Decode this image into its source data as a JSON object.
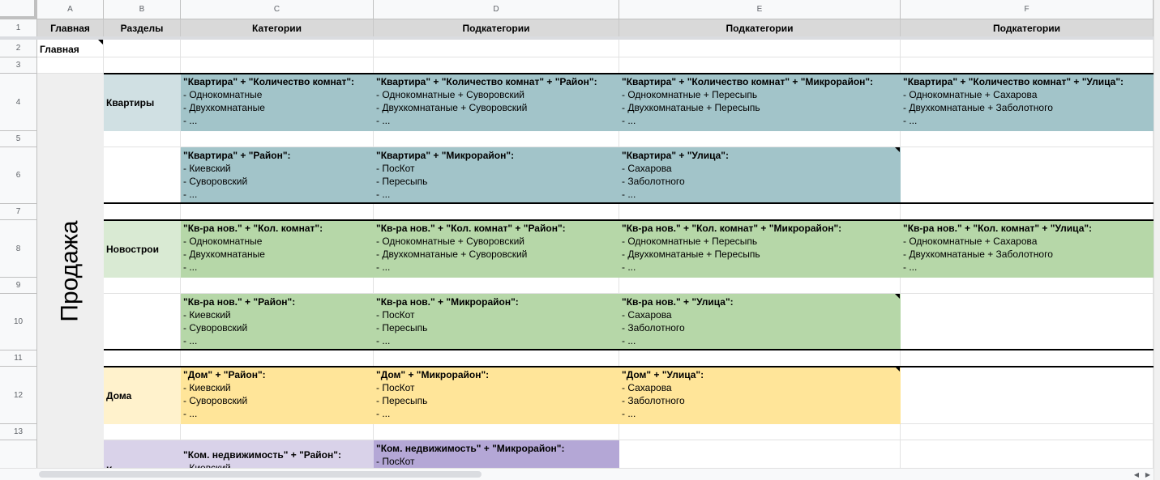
{
  "columns": [
    "A",
    "B",
    "C",
    "D",
    "E",
    "F"
  ],
  "rows": [
    "1",
    "2",
    "3",
    "4",
    "5",
    "6",
    "7",
    "8",
    "9",
    "10",
    "11",
    "12",
    "13"
  ],
  "header_row": [
    "Главная",
    "Разделы",
    "Категории",
    "Подкатегории",
    "Подкатегории",
    "Подкатегории"
  ],
  "a2": "Главная",
  "vertical_label": "Продажа",
  "sections": {
    "kvartiry": "Квартиры",
    "novostroi": "Новострои",
    "doma": "Дома",
    "kommercheskaya": "Коммерческая"
  },
  "r4": [
    {
      "title": "\"Квартира\" + \"Количество комнат\":",
      "lines": [
        "- Однокомнатные",
        "- Двухкомнатаные",
        "- ..."
      ]
    },
    {
      "title": "\"Квартира\" + \"Количество комнат\" + \"Район\":",
      "lines": [
        "- Однокомнатные + Суворовский",
        "- Двухкомнатаные + Суворовский",
        "- ..."
      ]
    },
    {
      "title": "\"Квартира\" + \"Количество комнат\" + \"Микрорайон\":",
      "lines": [
        "- Однокомнатные + Пересыпь",
        "- Двухкомнатаные + Пересыпь",
        "- ..."
      ]
    },
    {
      "title": "\"Квартира\" + \"Количество комнат\" + \"Улица\":",
      "lines": [
        "- Однокомнатные + Сахарова",
        "- Двухкомнатаные + Заболотного",
        "- ..."
      ]
    }
  ],
  "r6": [
    {
      "title": "\"Квартира\" + \"Район\":",
      "lines": [
        "- Киевский",
        "- Суворовский",
        "- ..."
      ]
    },
    {
      "title": "\"Квартира\" + \"Микрорайон\":",
      "lines": [
        "- ПосКот",
        "- Пересыпь",
        "- ..."
      ]
    },
    {
      "title": "\"Квартира\" + \"Улица\":",
      "lines": [
        "- Сахарова",
        "- Заболотного",
        "- ..."
      ]
    }
  ],
  "r8": [
    {
      "title": "\"Кв-ра нов.\" + \"Кол. комнат\":",
      "lines": [
        "- Однокомнатные",
        "- Двухкомнатаные",
        "- ..."
      ]
    },
    {
      "title": "\"Кв-ра нов.\" + \"Кол. комнат\" + \"Район\":",
      "lines": [
        "- Однокомнатные + Суворовский",
        "- Двухкомнатаные + Суворовский",
        "- ..."
      ]
    },
    {
      "title": "\"Кв-ра нов.\" + \"Кол. комнат\" + \"Микрорайон\":",
      "lines": [
        "- Однокомнатные + Пересыпь",
        "- Двухкомнатаные + Пересыпь",
        "- ..."
      ]
    },
    {
      "title": "\"Кв-ра нов.\" + \"Кол. комнат\" + \"Улица\":",
      "lines": [
        "- Однокомнатные + Сахарова",
        "- Двухкомнатаные + Заболотного",
        "- ..."
      ]
    }
  ],
  "r10": [
    {
      "title": "\"Кв-ра нов.\" + \"Район\":",
      "lines": [
        "- Киевский",
        "- Суворовский",
        "- ..."
      ]
    },
    {
      "title": "\"Кв-ра нов.\" + \"Микрорайон\":",
      "lines": [
        "- ПосКот",
        "- Пересыпь",
        "- ..."
      ]
    },
    {
      "title": "\"Кв-ра нов.\" + \"Улица\":",
      "lines": [
        "- Сахарова",
        "- Заболотного",
        "- ..."
      ]
    }
  ],
  "r12": [
    {
      "title": "\"Дом\" + \"Район\":",
      "lines": [
        "- Киевский",
        "- Суворовский",
        "- ..."
      ]
    },
    {
      "title": "\"Дом\" + \"Микрорайон\":",
      "lines": [
        "- ПосКот",
        "- Пересыпь",
        "- ..."
      ]
    },
    {
      "title": "\"Дом\" + \"Улица\":",
      "lines": [
        "- Сахарова",
        "- Заболотного",
        "- ..."
      ]
    }
  ],
  "r14": [
    {
      "title": "\"Ком. недвижимость\" + \"Район\":",
      "lines": [
        "- Киевский"
      ]
    },
    {
      "title": "\"Ком. недвижимость\" + \"Микрорайон\":",
      "lines": [
        "- ПосКот"
      ]
    }
  ],
  "scroll": {
    "left_arrow": "◀",
    "right_arrow": "▶"
  }
}
